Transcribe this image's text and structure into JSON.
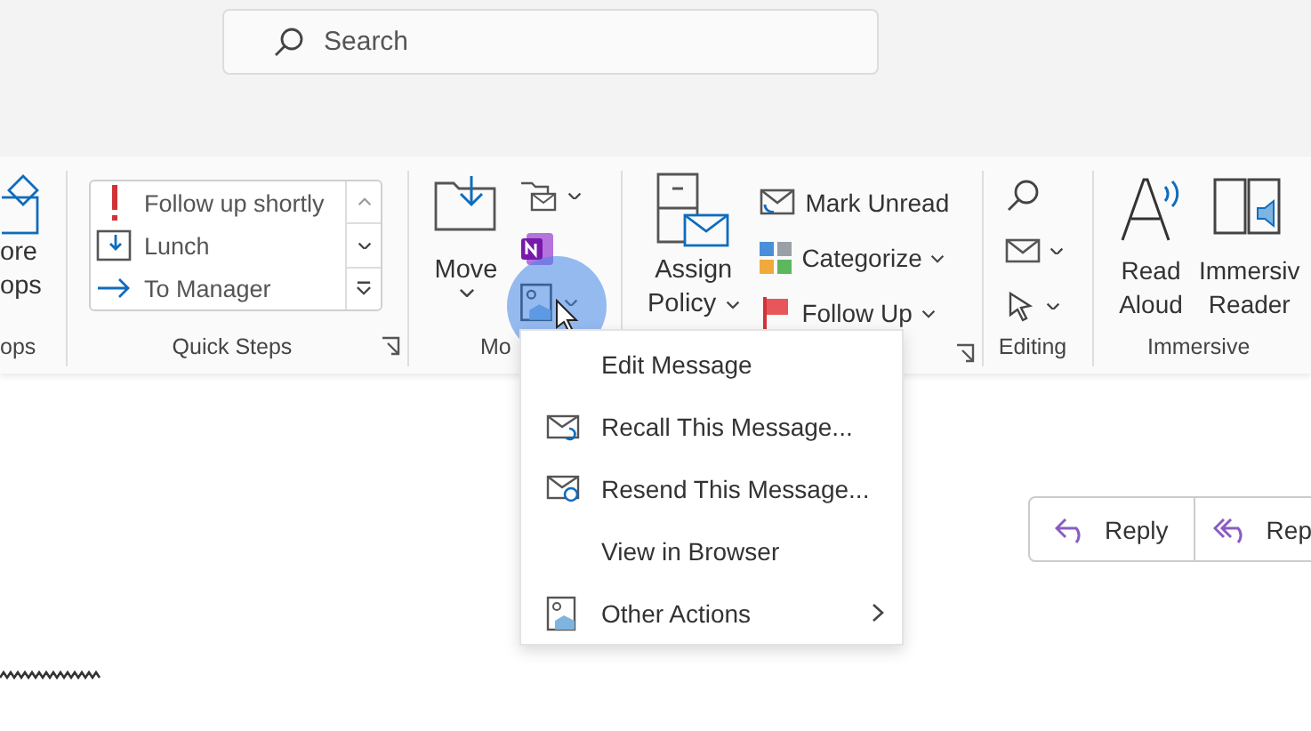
{
  "search": {
    "placeholder": "Search"
  },
  "more_apps": {
    "lines": [
      "ore",
      "ops"
    ],
    "group_label": "ops"
  },
  "quick_steps": {
    "items": [
      {
        "kind": "flag",
        "label": "Follow up shortly"
      },
      {
        "kind": "calendar",
        "label": "Lunch"
      },
      {
        "kind": "forward",
        "label": "To Manager"
      }
    ],
    "group_label": "Quick Steps"
  },
  "move": {
    "button": "Move",
    "group_label": "Mo"
  },
  "tags": {
    "assign_policy": [
      "Assign",
      "Policy"
    ],
    "items": [
      {
        "kind": "unread",
        "label": "Mark Unread",
        "has_menu": false
      },
      {
        "kind": "categorize",
        "label": "Categorize",
        "has_menu": true
      },
      {
        "kind": "flag",
        "label": "Follow Up",
        "has_menu": true
      }
    ]
  },
  "editing": {
    "group_label": "Editing"
  },
  "immersive": {
    "buttons": [
      {
        "kind": "read_aloud",
        "lines": [
          "Read",
          "Aloud"
        ]
      },
      {
        "kind": "reader",
        "lines": [
          "Immersiv",
          "Reader"
        ]
      }
    ],
    "group_label": "Immersive"
  },
  "menu": {
    "items": [
      {
        "kind": "plain",
        "label": "Edit Message",
        "has_submenu": false
      },
      {
        "kind": "recall",
        "label": "Recall This Message...",
        "has_submenu": false
      },
      {
        "kind": "resend",
        "label": "Resend This Message...",
        "has_submenu": false
      },
      {
        "kind": "plain",
        "label": "View in Browser",
        "has_submenu": false
      },
      {
        "kind": "other",
        "label": "Other Actions",
        "has_submenu": true
      }
    ]
  },
  "reply_buttons": [
    {
      "kind": "reply",
      "label": "Reply"
    },
    {
      "kind": "reply_all",
      "label": "Rep"
    }
  ]
}
